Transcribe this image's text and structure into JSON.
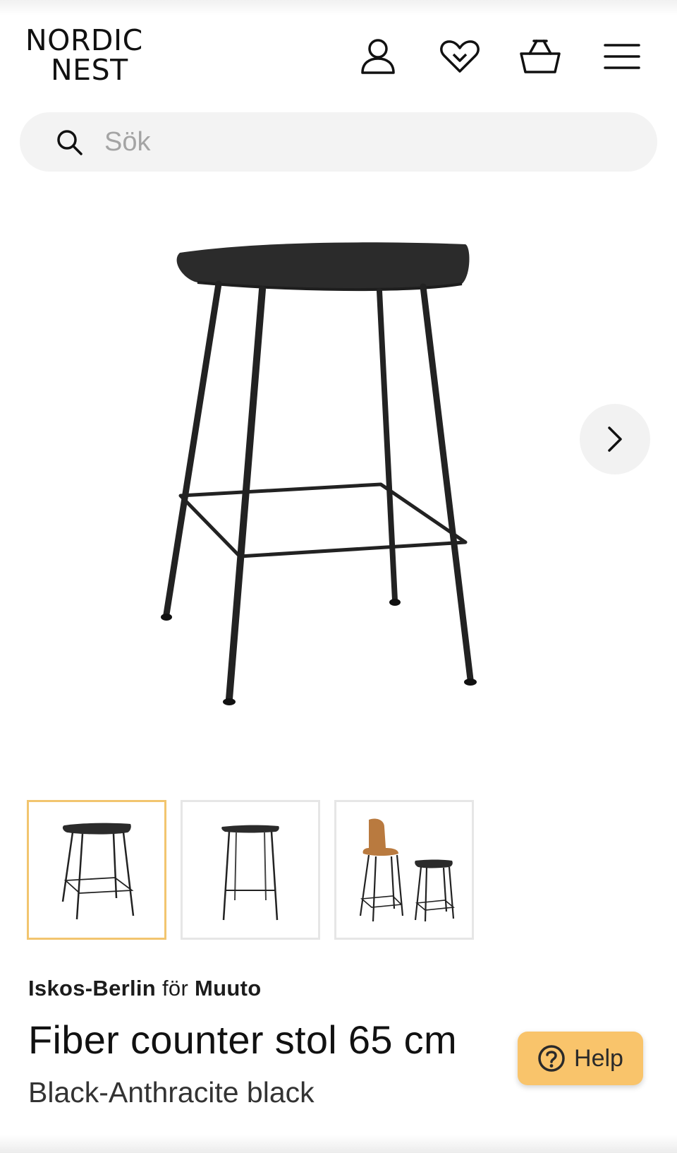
{
  "header": {
    "logo_line1": "NORDIC",
    "logo_line2": "NEST",
    "icons": [
      "user-icon",
      "heart-icon",
      "basket-icon",
      "menu-icon"
    ]
  },
  "search": {
    "placeholder": "Sök"
  },
  "gallery": {
    "thumbnails": [
      {
        "name": "thumb-stool-angle",
        "selected": true
      },
      {
        "name": "thumb-stool-front",
        "selected": false
      },
      {
        "name": "thumb-stool-pair",
        "selected": false
      }
    ]
  },
  "product": {
    "designer": "Iskos-Berlin",
    "for_word": "för",
    "maker": "Muuto",
    "title": "Fiber counter stol 65 cm",
    "variant": "Black-Anthracite black"
  },
  "help_button": {
    "label": "Help"
  },
  "colors": {
    "accent": "#f9c46b",
    "selected_thumb_border": "#f2c56f",
    "search_bg": "#f3f3f3"
  }
}
